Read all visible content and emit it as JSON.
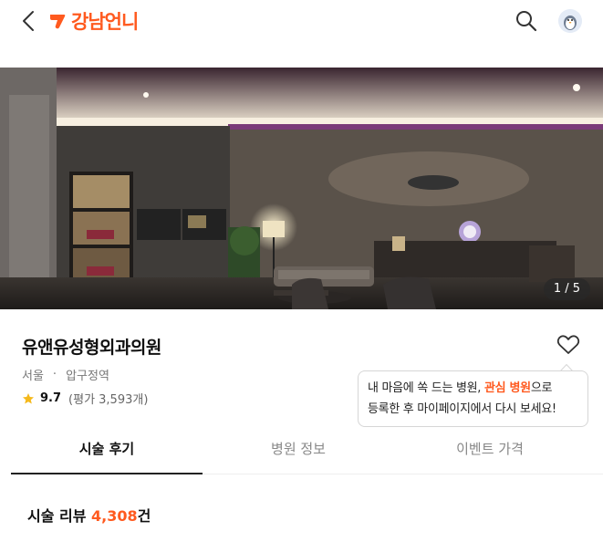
{
  "header": {
    "logo_text": "강남언니",
    "brand_color": "#ff5a1f",
    "icons": [
      "back-arrow-icon",
      "search-icon",
      "avatar"
    ]
  },
  "hero": {
    "photo_counter": "1 / 5"
  },
  "clinic": {
    "name": "유앤유성형외과의원",
    "city": "서울",
    "station": "압구정역",
    "rating": "9.7",
    "rating_count": "(평가 3,593개)"
  },
  "tooltip": {
    "text_before": "내 마음에 쏙 드는 병원, ",
    "highlight": "관심 병원",
    "text_after": "으로",
    "line2": "등록한 후 마이페이지에서 다시 보세요!"
  },
  "tabs": [
    {
      "label": "시술 후기",
      "active": true
    },
    {
      "label": "병원 정보",
      "active": false
    },
    {
      "label": "이벤트 가격",
      "active": false
    }
  ],
  "reviews": {
    "label": "시술 리뷰",
    "count": "4,308",
    "suffix": "건"
  }
}
